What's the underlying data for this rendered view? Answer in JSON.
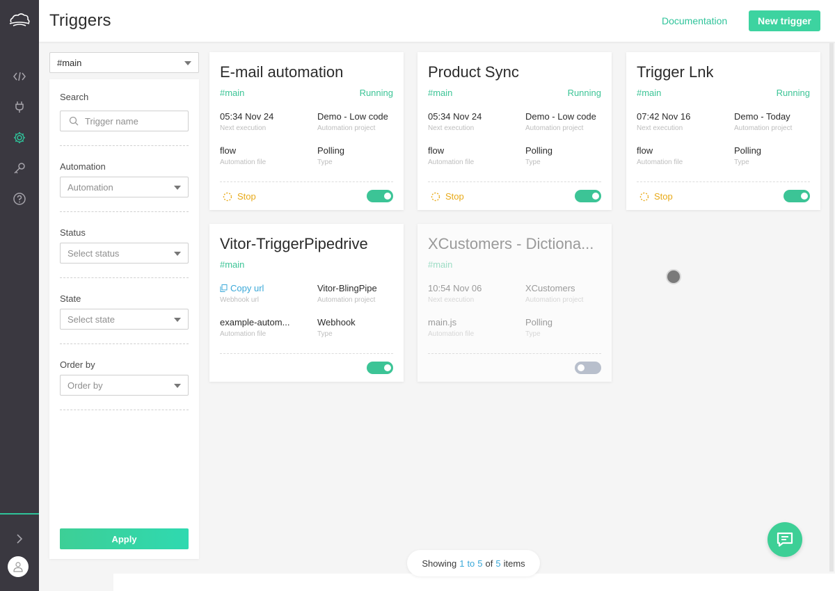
{
  "header": {
    "title": "Triggers",
    "documentation_label": "Documentation",
    "new_trigger_label": "New trigger"
  },
  "rail": {
    "icons": [
      "cloud-logo-icon",
      "code-icon",
      "plug-icon",
      "gear-icon",
      "key-icon",
      "help-icon",
      "chevron-right-icon",
      "user-icon"
    ],
    "active": "gear-icon"
  },
  "branch_select": {
    "value": "#main"
  },
  "filters": {
    "search_label": "Search",
    "search_placeholder": "Trigger name",
    "automation_label": "Automation",
    "automation_placeholder": "Automation",
    "status_label": "Status",
    "status_placeholder": "Select status",
    "state_label": "State",
    "state_placeholder": "Select state",
    "order_label": "Order by",
    "order_placeholder": "Order by",
    "apply_label": "Apply"
  },
  "cards": [
    {
      "title": "E-mail automation",
      "branch": "#main",
      "status": "Running",
      "v1": "05:34 Nov 24",
      "s1": "Next execution",
      "v2": "Demo - Low code",
      "s2": "Automation project",
      "v3": "flow",
      "s3": "Automation file",
      "v4": "Polling",
      "s4": "Type",
      "action": "Stop",
      "enabled": true
    },
    {
      "title": "Product Sync",
      "branch": "#main",
      "status": "Running",
      "v1": "05:34 Nov 24",
      "s1": "Next execution",
      "v2": "Demo - Low code",
      "s2": "Automation project",
      "v3": "flow",
      "s3": "Automation file",
      "v4": "Polling",
      "s4": "Type",
      "action": "Stop",
      "enabled": true
    },
    {
      "title": "Trigger Lnk",
      "branch": "#main",
      "status": "Running",
      "v1": "07:42 Nov 16",
      "s1": "Next execution",
      "v2": "Demo - Today",
      "s2": "Automation project",
      "v3": "flow",
      "s3": "Automation file",
      "v4": "Polling",
      "s4": "Type",
      "action": "Stop",
      "enabled": true
    },
    {
      "title": "Vitor-TriggerPipedrive",
      "branch": "#main",
      "v1": "Copy url",
      "s1": "Webhook url",
      "v2": "Vitor-BlingPipe",
      "s2": "Automation project",
      "v3": "example-autom...",
      "s3": "Automation file",
      "v4": "Webhook",
      "s4": "Type",
      "enabled": true
    },
    {
      "title": "XCustomers - Dictiona...",
      "branch": "#main",
      "v1": "10:54 Nov 06",
      "s1": "Next execution",
      "v2": "XCustomers",
      "s2": "Automation project",
      "v3": "main.js",
      "s3": "Automation file",
      "v4": "Polling",
      "s4": "Type",
      "enabled": false
    }
  ],
  "pager": {
    "prefix": "Showing",
    "from": "1",
    "to_word": "to",
    "to": "5",
    "of_word": "of",
    "total": "5",
    "suffix": "items"
  },
  "colors": {
    "accent": "#3dcf96",
    "running": "#3cc496",
    "stop": "#e8a917",
    "link": "#3aa8d8",
    "rail": "#3a3840"
  }
}
